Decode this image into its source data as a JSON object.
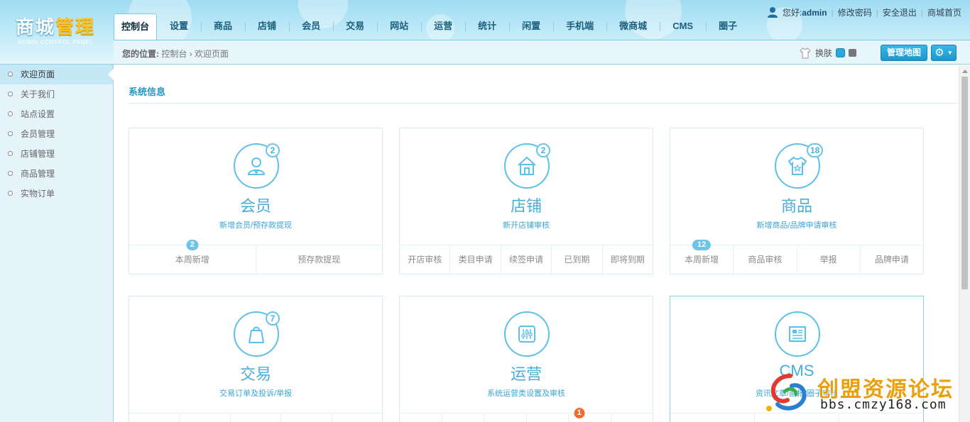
{
  "brand": {
    "title_part1": "商城",
    "title_part2": "管理",
    "subtitle": "ADMIN CONTROL PANEL"
  },
  "top_links": {
    "greeting": "您好",
    "username": "admin",
    "change_password": "修改密码",
    "logout": "安全退出",
    "mall_home": "商城首页"
  },
  "nav": {
    "tabs": [
      {
        "label": "控制台",
        "active": true
      },
      {
        "label": "设置"
      },
      {
        "label": "商品"
      },
      {
        "label": "店铺"
      },
      {
        "label": "会员"
      },
      {
        "label": "交易"
      },
      {
        "label": "网站"
      },
      {
        "label": "运营"
      },
      {
        "label": "统计"
      },
      {
        "label": "闲置"
      },
      {
        "label": "手机端"
      },
      {
        "label": "微商城"
      },
      {
        "label": "CMS"
      },
      {
        "label": "圈子"
      }
    ]
  },
  "subbar": {
    "location_label": "您的位置:",
    "crumb_root": "控制台",
    "crumb_sep": "›",
    "crumb_current": "欢迎页面",
    "skin_label": "换肤",
    "map_button": "管理地图"
  },
  "sidebar": {
    "items": [
      {
        "label": "欢迎页面",
        "active": true
      },
      {
        "label": "关于我们"
      },
      {
        "label": "站点设置"
      },
      {
        "label": "会员管理"
      },
      {
        "label": "店铺管理"
      },
      {
        "label": "商品管理"
      },
      {
        "label": "实物订单"
      }
    ]
  },
  "main": {
    "section_title": "系统信息",
    "cards": [
      {
        "title": "会员",
        "desc": "新增会员/预存款提现",
        "badge": "2",
        "icon": "user-icon",
        "links": [
          {
            "label": "本周新增",
            "count": "2"
          },
          {
            "label": "预存款提现"
          }
        ]
      },
      {
        "title": "店铺",
        "desc": "新开店铺审核",
        "badge": "2",
        "icon": "store-icon",
        "links": [
          {
            "label": "开店审核"
          },
          {
            "label": "类目申请"
          },
          {
            "label": "续签申请"
          },
          {
            "label": "已到期"
          },
          {
            "label": "即将到期"
          }
        ]
      },
      {
        "title": "商品",
        "desc": "新增商品/品牌申请审核",
        "badge": "18",
        "icon": "tshirt-icon",
        "links": [
          {
            "label": "本周新增",
            "count": "12"
          },
          {
            "label": "商品审核"
          },
          {
            "label": "举报"
          },
          {
            "label": "品牌申请"
          }
        ]
      },
      {
        "title": "交易",
        "desc": "交易订单及投诉/举报",
        "badge": "7",
        "icon": "bag-icon"
      },
      {
        "title": "运营",
        "desc": "系统运营类设置及审核",
        "icon": "sliders-icon",
        "alert_count": "1"
      },
      {
        "title": "CMS",
        "desc": "资讯文章/画报/圈子审核",
        "icon": "document-icon"
      }
    ]
  },
  "watermark": {
    "text": "创盟资源论坛",
    "url": "bbs.cmzy168.com"
  },
  "colors": {
    "accent": "#2397c8",
    "circle": "#5ec0e8",
    "alert": "#f26a2e",
    "brand_yellow": "#ffc21e"
  }
}
